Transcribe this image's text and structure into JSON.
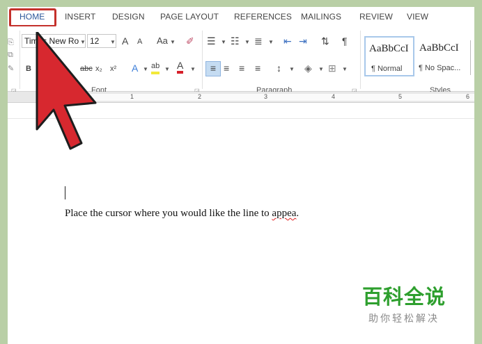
{
  "tabs": [
    "HOME",
    "INSERT",
    "DESIGN",
    "PAGE LAYOUT",
    "REFERENCES",
    "MAILINGS",
    "REVIEW",
    "VIEW"
  ],
  "font": {
    "name": "Times New Ro",
    "size": "12",
    "grow": "A",
    "shrink": "A",
    "case_label": "Aa"
  },
  "format_buttons": {
    "bold": "B",
    "strike": "abc",
    "subscript": "x₂",
    "superscript": "x²",
    "text_effects": "A",
    "highlight": "ab",
    "font_color": "A"
  },
  "groups": {
    "font": "Font",
    "paragraph": "Paragraph",
    "styles": "Styles"
  },
  "styles": [
    {
      "preview": "AaBbCcI",
      "name": "¶ Normal"
    },
    {
      "preview": "AaBbCcI",
      "name": "¶ No Spac..."
    }
  ],
  "ruler_numbers": [
    "1",
    "2",
    "3",
    "4",
    "5",
    "6"
  ],
  "document": {
    "text_before": "Place the cursor where you would like the line to ",
    "text_misspelled": "appea",
    "text_after": "."
  },
  "watermark": {
    "title": "百科全说",
    "subtitle": "助你轻松解决"
  },
  "colors": {
    "accent": "#2b579a",
    "callout": "#d7282f",
    "watermark": "#2e9f2e",
    "background": "#b9cfa6"
  }
}
